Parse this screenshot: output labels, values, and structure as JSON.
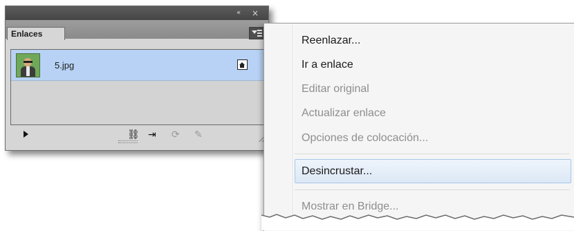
{
  "panel": {
    "tab_label": "Enlaces",
    "collapse_icon": "«",
    "close_icon": "×",
    "links": [
      {
        "file_name": "5.jpg",
        "status_icon": "embedded-icon"
      }
    ],
    "toolbar": [
      {
        "name": "play-icon"
      },
      {
        "name": "relink-icon",
        "glyph": "⛓"
      },
      {
        "name": "goto-link-icon",
        "glyph": "⇥"
      },
      {
        "name": "update-link-icon",
        "glyph": "⟳"
      },
      {
        "name": "edit-original-icon",
        "glyph": "✎"
      }
    ]
  },
  "context_menu": {
    "items": [
      {
        "label": "Reenlazar...",
        "enabled": true
      },
      {
        "label": "Ir a enlace",
        "enabled": true
      },
      {
        "label": "Editar original",
        "enabled": false
      },
      {
        "label": "Actualizar enlace",
        "enabled": false
      },
      {
        "label": "Opciones de colocación...",
        "enabled": false
      },
      {
        "label": "Desincrustar...",
        "enabled": true,
        "highlighted": true
      },
      {
        "label": "Mostrar en Bridge...",
        "enabled": false
      }
    ]
  }
}
